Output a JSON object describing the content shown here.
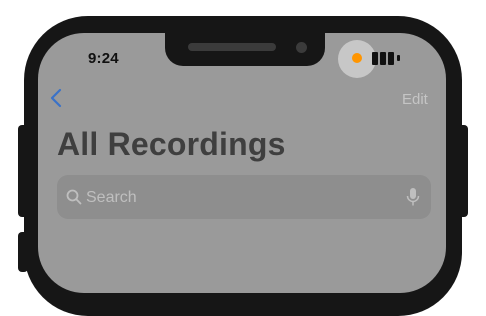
{
  "status_bar": {
    "time": "9:24",
    "recording_indicator_color": "#ff9500",
    "battery_icon": "battery-icon"
  },
  "nav": {
    "back_icon": "chevron-left-icon",
    "edit_label": "Edit"
  },
  "main": {
    "title": "All Recordings"
  },
  "search": {
    "placeholder": "Search",
    "search_icon": "search-icon",
    "mic_icon": "microphone-icon"
  },
  "colors": {
    "screen_dim": "#9a9a9a",
    "accent_blue": "#3a72c8"
  }
}
